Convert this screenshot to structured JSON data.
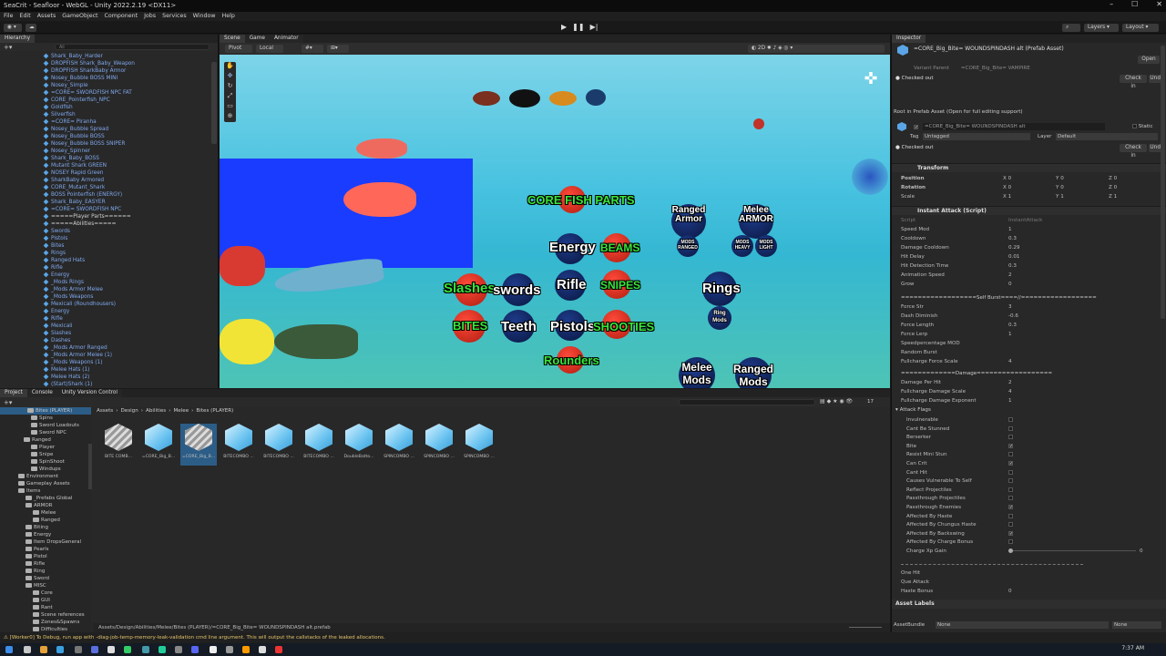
{
  "window": {
    "title": "SeaCrit - Seafloor - WebGL - Unity 2022.2.19 <DX11>"
  },
  "menu": [
    "File",
    "Edit",
    "Assets",
    "GameObject",
    "Component",
    "Jobs",
    "Services",
    "Window",
    "Help"
  ],
  "toolbar": {
    "layers": "Layers",
    "layout": "Layout"
  },
  "hierarchy": {
    "tab": "Hierarchy",
    "search_placeholder": "All",
    "items": [
      "Shark_Baby_Harder",
      "DROPFISH Shark_Baby_Weapon",
      "DROPFISH SharkBaby Armor",
      "Nosey_Bubble BOSS MINI",
      "Nosey_Simple",
      "=CORE= SWORDFISH NPC FAT",
      "CORE_Pointerfish_NPC",
      "Goldfish",
      "Silverfish",
      "=CORE= Piranha",
      "Nosey_Bubble Spread",
      "Nosey_Bubble BOSS",
      "Nosey_Bubble BOSS SNIPER",
      "Nosey_Spinner",
      "Shark_Baby_BOSS",
      "Mutant Shark GREEN",
      "NOSEY Rapid Green",
      "SharkBaby Armored",
      "CORE_Mutant_Shark",
      "BOSS Pointerfish (ENERGY)",
      "Shark_Baby_EASYER",
      "=CORE= SWORDFISH NPC",
      "=====Player Parts======",
      "=====Abilities=====",
      "Swords",
      "Pistols",
      "Bites",
      "Rings",
      "Ranged Hats",
      "Rifle",
      "Energy",
      "_Mods Rings",
      "_Mods Armor Melee",
      "_Mods Weapons",
      "Mexicali (Roundhousers)",
      "Energy",
      "Rifle",
      "Mexicali",
      "Slashes",
      "Dashes",
      "_Mods Armor Ranged",
      "_Mods Armor Melee (1)",
      "_Mods Weapons (1)",
      "Melee Hats (1)",
      "Melee Hats (2)",
      "(Start)Shark (1)"
    ]
  },
  "scene": {
    "tabs": [
      "Scene",
      "Game",
      "Animator"
    ],
    "tool_pivot": "Pivot",
    "tool_local": "Local",
    "labels": {
      "core_fish_parts": "CORE FISH PARTS",
      "energy": "Energy",
      "beams": "BEAMS",
      "slashes": "Slashes",
      "swords": "swords",
      "rifle": "Rifle",
      "snipes": "SNIPES",
      "bites": "BITES",
      "teeth": "Teeth",
      "pistols": "Pistols",
      "shooties": "SHOOTIES",
      "rounders": "Rounders",
      "ranged_armor": "Ranged Armor",
      "melee_armor": "Melee ARMOR",
      "mods_ranged": "MODS RANGED",
      "mods_heavy": "MODS HEAVY",
      "mods_light": "MODS LIGHT",
      "rings": "Rings",
      "ring_mods": "Ring Mods",
      "melee_mods": "Melee Mods",
      "ranged_mods": "Ranged Mods"
    }
  },
  "inspector": {
    "tab": "Inspector",
    "asset_name": "=CORE_Big_Bite= WOUNDSPINDASH alt (Prefab Asset)",
    "open_label": "Open",
    "variant_parent_label": "Variant Parent",
    "variant_parent_value": "=CORE_Big_Bite= VAMPIRE",
    "checked_out": "Checked out",
    "check_in": "Check in",
    "undo": "Undo",
    "root_prefab": "Root in Prefab Asset (Open for full editing support)",
    "object_name": "=CORE_Big_Bite= WOUNDSPINDASH alt",
    "static_label": "Static",
    "tag_label": "Tag",
    "tag_value": "Untagged",
    "layer_label": "Layer",
    "layer_value": "Default",
    "transform": {
      "title": "Transform",
      "position": {
        "label": "Position",
        "x": "0",
        "y": "0",
        "z": "0"
      },
      "rotation": {
        "label": "Rotation",
        "x": "0",
        "y": "0",
        "z": "0"
      },
      "scale": {
        "label": "Scale",
        "x": "1",
        "y": "1",
        "z": "1"
      }
    },
    "instant_attack": {
      "title": "Instant Attack (Script)",
      "script_label": "Script",
      "script_value": "InstantAttack",
      "fields": [
        {
          "label": "Speed Mod",
          "value": "1"
        },
        {
          "label": "Cooldown",
          "value": "0.3"
        },
        {
          "label": "Damage Cooldown",
          "value": "0.29"
        },
        {
          "label": "Hit Delay",
          "value": "0.01"
        },
        {
          "label": "Hit Detection Time",
          "value": "0.3"
        },
        {
          "label": "Animation Speed",
          "value": "2"
        },
        {
          "label": "Grow",
          "value": "0"
        }
      ],
      "self_burst_header": "==================Self Burst====//==================",
      "self_burst_fields": [
        {
          "label": "Force Str",
          "value": "3"
        },
        {
          "label": "Dash Diminish",
          "value": "-0.6"
        },
        {
          "label": "Force Length",
          "value": "0.3"
        },
        {
          "label": "Force Lerp",
          "value": "1"
        },
        {
          "label": "Speedpercentage MOD",
          "value": ""
        },
        {
          "label": "Random Burst",
          "value": ""
        },
        {
          "label": "Fullcharge Force Scale",
          "value": "4"
        }
      ],
      "damage_header": "=============Damage==================",
      "damage_fields": [
        {
          "label": "Damage Per Hit",
          "value": "2"
        },
        {
          "label": "Fullcharge Damage Scale",
          "value": "4"
        },
        {
          "label": "Fullcharge Damage Exponent",
          "value": "1"
        }
      ],
      "attack_flags_label": "Attack Flags",
      "flags": [
        {
          "label": "Invulnerable",
          "on": false
        },
        {
          "label": "Cant Be Stunned",
          "on": false
        },
        {
          "label": "Berserker",
          "on": false
        },
        {
          "label": "Bite",
          "on": true
        },
        {
          "label": "Resist Mini Stun",
          "on": false
        },
        {
          "label": "Can Crit",
          "on": true
        },
        {
          "label": "Cant Hit",
          "on": false
        },
        {
          "label": "Causes Vulnerable To Self",
          "on": false
        },
        {
          "label": "Reflect Projectiles",
          "on": false
        },
        {
          "label": "Passthrough Projectiles",
          "on": false
        },
        {
          "label": "Passthrough Enemies",
          "on": true
        },
        {
          "label": "Affected By Haste",
          "on": false
        },
        {
          "label": "Affected By Chungus Haste",
          "on": false
        },
        {
          "label": "Affected By Backswing",
          "on": true
        },
        {
          "label": "Affected By Charge Bonus",
          "on": false
        }
      ],
      "charge_xp_label": "Charge Xp Gain",
      "charge_xp_value": "0",
      "bottom_fields": [
        {
          "label": "One Hit",
          "value": ""
        },
        {
          "label": "Que Attack",
          "value": ""
        },
        {
          "label": "Haste Bonus",
          "value": "0"
        }
      ]
    },
    "asset_labels": "Asset Labels",
    "asset_bundle_label": "AssetBundle",
    "asset_bundle_value": "None",
    "asset_bundle_variant": "None"
  },
  "project": {
    "tabs": [
      "Project",
      "Console",
      "Unity Version Control"
    ],
    "breadcrumb": [
      "Assets",
      "Design",
      "Abilities",
      "Melee",
      "Bites (PLAYER)"
    ],
    "tree": [
      "Bites (PLAYER)",
      "Spins",
      "Sword Loadouts",
      "Sword NPC",
      "Ranged",
      "Player",
      "Snipe",
      "SpinShoot",
      "Windups",
      "Environment",
      "Gameplay Assets",
      "Items",
      "_Prefabs Global",
      "ARMOR",
      "Melee",
      "Ranged",
      "Biting",
      "Energy",
      "Item DropsGeneral",
      "Pearls",
      "Pistol",
      "Rifle",
      "Ring",
      "Sword",
      "MISC",
      "Core",
      "GUI",
      "Rant",
      "Scene references",
      "Zones&Spawns",
      "Difficulties"
    ],
    "assets": [
      "BITE COMB...",
      "=CORE_Big_B...",
      "=CORE_Big_B...",
      "BITECOMBO ...",
      "BITECOMBO ...",
      "BITECOMBO ...",
      "DoubleBatto...",
      "SPINCOMBO ...",
      "SPINCOMBO ...",
      "SPINCOMBO ..."
    ],
    "path": "Assets/Design/Abilities/Melee/Bites (PLAYER)/=CORE_Big_Bite= WOUNDSPINDASH alt.prefab",
    "count": "17"
  },
  "status": "[Worker0] To Debug, run app with -diag-job-temp-memory-leak-validation cmd line argument. This will output the callstacks of the leaked allocations.",
  "clock": "7:37 AM"
}
